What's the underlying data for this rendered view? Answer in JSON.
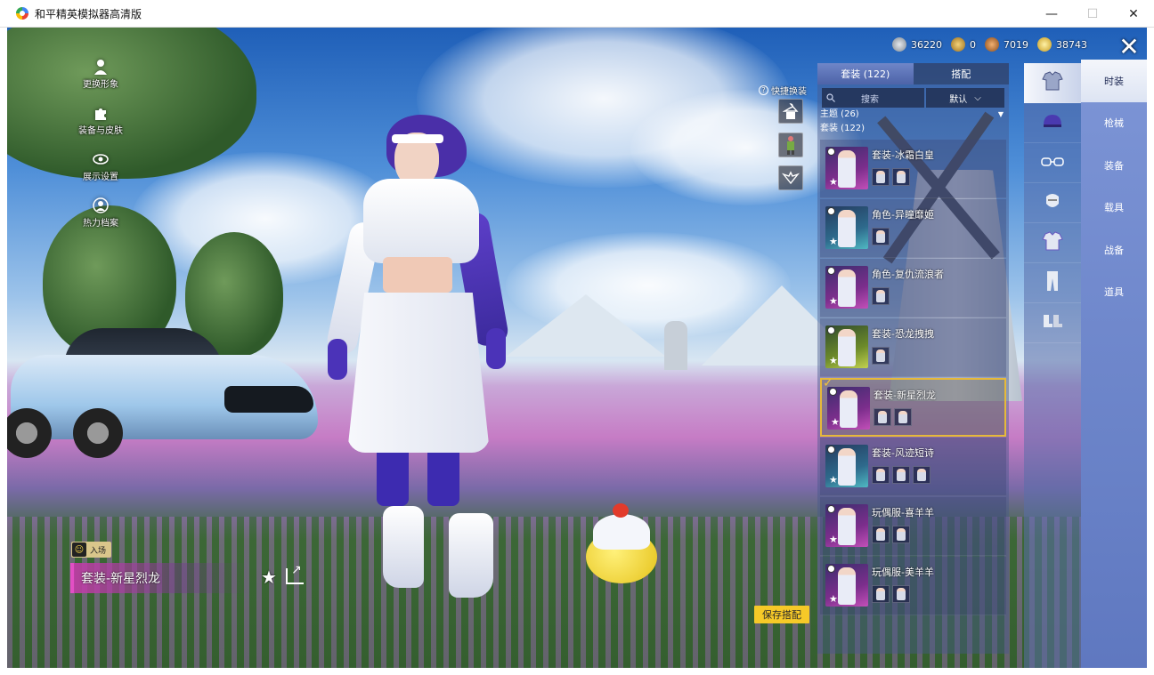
{
  "window": {
    "title": "和平精英模拟器高清版",
    "minimize": "—",
    "maximize": "☐",
    "close": "✕"
  },
  "left_menu": [
    {
      "label": "更换形象",
      "icon": "person-icon"
    },
    {
      "label": "装备与皮肤",
      "icon": "puzzle-icon"
    },
    {
      "label": "展示设置",
      "icon": "eye-icon"
    },
    {
      "label": "热力档案",
      "icon": "profile-icon"
    }
  ],
  "currency": [
    {
      "value": "36220",
      "icon": "silver-coin-icon",
      "color": "#9aa3ad"
    },
    {
      "value": "0",
      "icon": "gold-medal-icon",
      "color": "#c79a2e"
    },
    {
      "value": "7019",
      "icon": "bronze-coin-icon",
      "color": "#c7782e"
    },
    {
      "value": "38743",
      "icon": "diamond-coin-icon",
      "color": "#e6c64a"
    }
  ],
  "close_label": "✕",
  "quick_change": {
    "label": "快捷换装",
    "q": "?"
  },
  "outfit_panel": {
    "tabs": [
      {
        "label": "套装 (122)",
        "active": true
      },
      {
        "label": "搭配",
        "active": false
      }
    ],
    "search_placeholder": "搜索",
    "sort_label": "默认",
    "sort_caret": "⌵",
    "category_theme": "主题 (26)",
    "category_theme_caret": "▼",
    "category_suit": "套装 (122)",
    "items": [
      {
        "name": "套装-冰霜白皇",
        "thumb": "pink",
        "minis": 2,
        "selected": false
      },
      {
        "name": "角色-异瞳靡姬",
        "thumb": "teal",
        "minis": 1,
        "selected": false
      },
      {
        "name": "角色-复仇流浪者",
        "thumb": "pink",
        "minis": 1,
        "selected": false
      },
      {
        "name": "套装-恐龙拽拽",
        "thumb": "gold",
        "minis": 1,
        "selected": false
      },
      {
        "name": "套装-新星烈龙",
        "thumb": "pink",
        "minis": 2,
        "selected": true
      },
      {
        "name": "套装-风迹短诗",
        "thumb": "teal",
        "minis": 3,
        "selected": false
      },
      {
        "name": "玩偶服-喜羊羊",
        "thumb": "pink",
        "minis": 2,
        "selected": false
      },
      {
        "name": "玩偶服-美羊羊",
        "thumb": "pink",
        "minis": 2,
        "selected": false
      }
    ]
  },
  "categories": [
    {
      "label": "时装",
      "icon": "outfit-icon",
      "active": true
    },
    {
      "label": "枪械",
      "icon": "helmet-icon",
      "active": false
    },
    {
      "label": "装备",
      "icon": "goggles-icon",
      "active": false
    },
    {
      "label": "载具",
      "icon": "mask-icon",
      "active": false
    },
    {
      "label": "战备",
      "icon": "top-icon",
      "active": false
    },
    {
      "label": "道具",
      "icon": "pants-icon",
      "active": false
    },
    {
      "label": "",
      "icon": "shoes-icon",
      "active": false
    }
  ],
  "entry_badge": {
    "label": "入场",
    "icon": "smile-icon"
  },
  "current_outfit_name": "套装-新星烈龙",
  "favorite_star": "★",
  "save_button": "保存搭配",
  "colors": {
    "accent_gold": "#f6c928",
    "selected_border": "#e6b93a",
    "name_bar_pink": "#c43caa",
    "panel_blue": "#5f78c0"
  }
}
